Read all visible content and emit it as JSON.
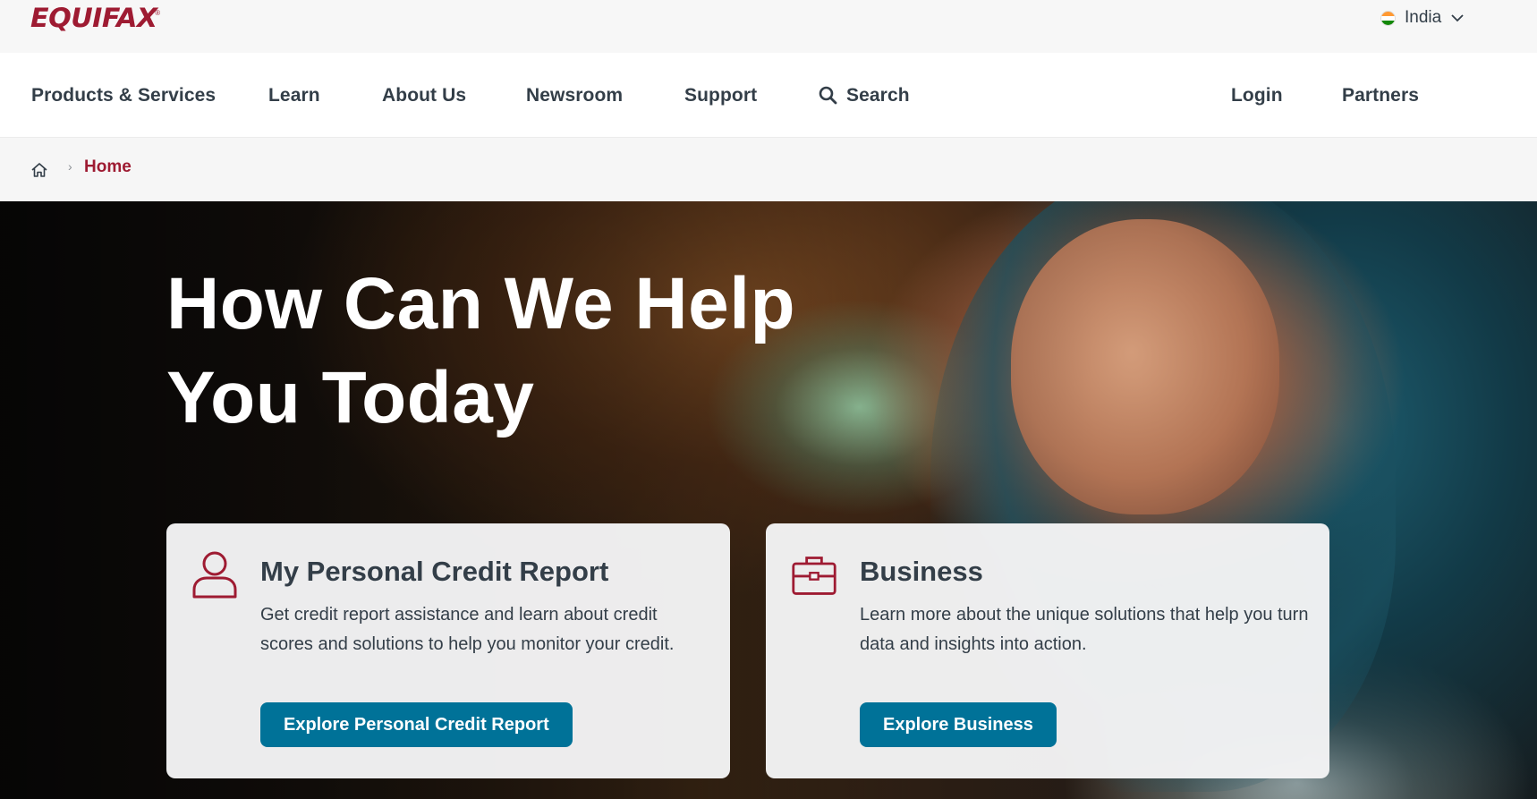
{
  "brand": {
    "name": "EQUIFAX",
    "reg_mark": "®",
    "color": "#9e1b32"
  },
  "country_selector": {
    "label": "India",
    "flag": "india-flag-icon",
    "icon": "chevron-down-icon"
  },
  "nav": {
    "items": [
      {
        "label": "Products & Services"
      },
      {
        "label": "Learn"
      },
      {
        "label": "About Us"
      },
      {
        "label": "Newsroom"
      },
      {
        "label": "Support"
      },
      {
        "label": "Search",
        "icon": "search-icon"
      }
    ],
    "right": [
      {
        "label": "Login"
      },
      {
        "label": "Partners"
      }
    ]
  },
  "breadcrumb": {
    "home_icon": "home-icon",
    "separator": "›",
    "current": "Home"
  },
  "hero": {
    "title_line1": "How Can We Help",
    "title_line2": "You Today",
    "cards": [
      {
        "icon": "user-icon",
        "title": "My Personal Credit Report",
        "description": "Get credit report assistance and learn about credit scores and solutions to help you monitor your credit.",
        "button": "Explore Personal Credit Report"
      },
      {
        "icon": "briefcase-icon",
        "title": "Business",
        "description": "Learn more about the unique solutions that help you turn data and insights into action.",
        "button": "Explore Business"
      }
    ]
  },
  "colors": {
    "accent": "#9e1b32",
    "button": "#007298",
    "text": "#333e48"
  }
}
